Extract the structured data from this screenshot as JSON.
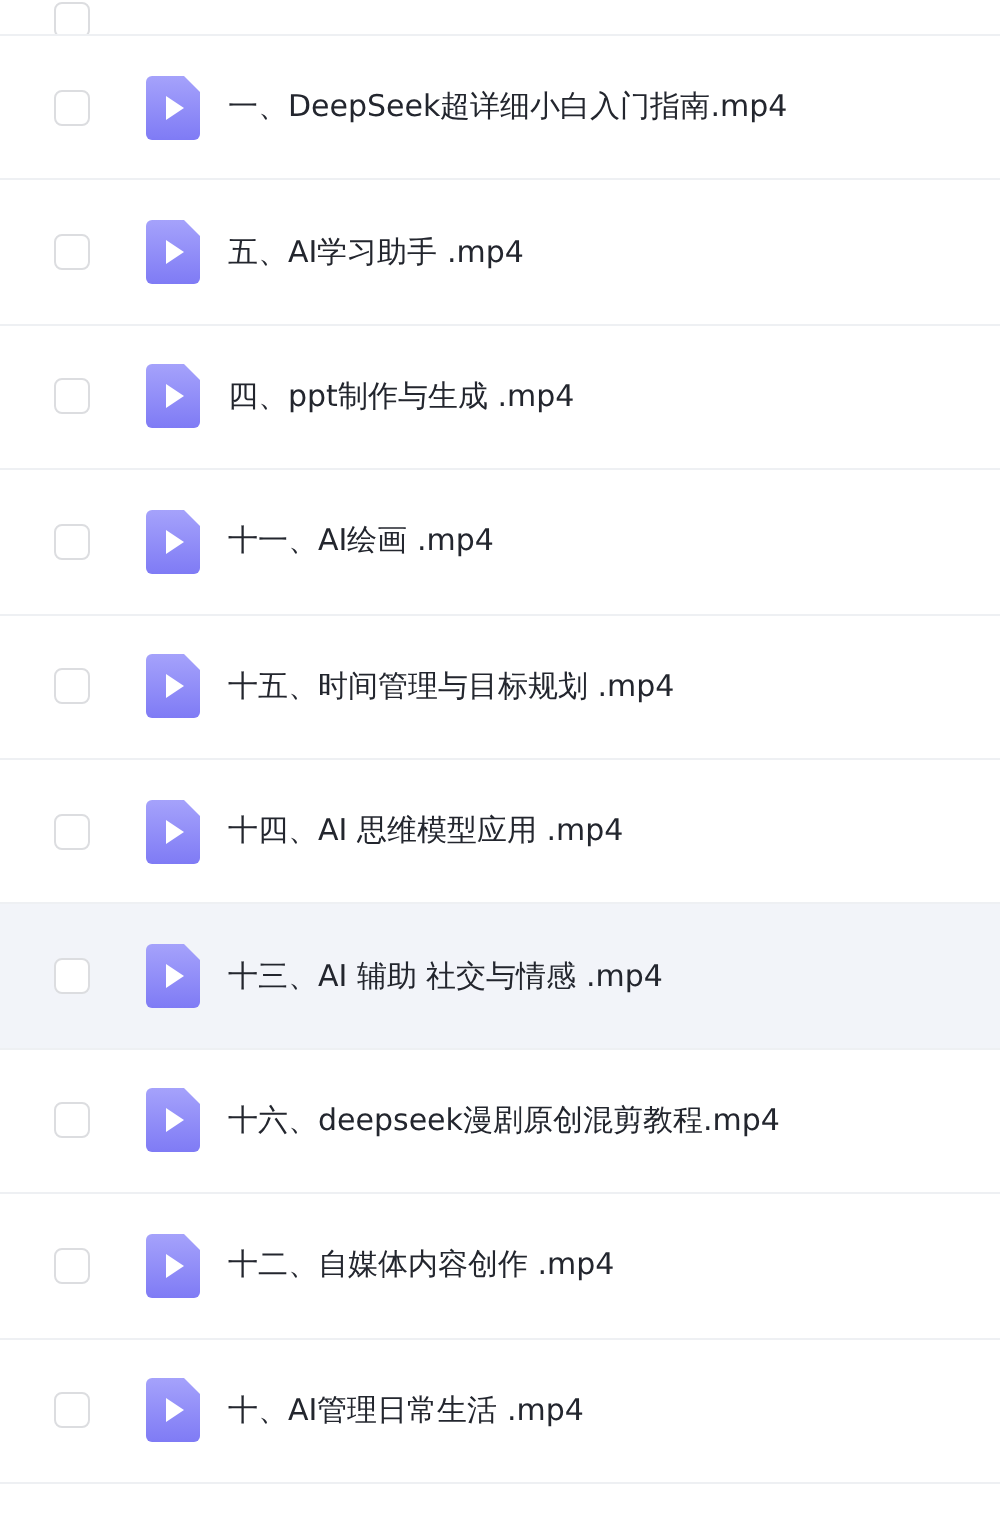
{
  "partial_row": {
    "checked": false
  },
  "files": [
    {
      "name": "一、DeepSeek超详细小白入门指南.mp4",
      "checked": false,
      "hovered": false
    },
    {
      "name": "五、AI学习助手 .mp4",
      "checked": false,
      "hovered": false
    },
    {
      "name": "四、ppt制作与生成 .mp4",
      "checked": false,
      "hovered": false
    },
    {
      "name": "十一、AI绘画 .mp4",
      "checked": false,
      "hovered": false
    },
    {
      "name": "十五、时间管理与目标规划 .mp4",
      "checked": false,
      "hovered": false
    },
    {
      "name": "十四、AI 思维模型应用 .mp4",
      "checked": false,
      "hovered": false
    },
    {
      "name": "十三、AI 辅助 社交与情感 .mp4",
      "checked": false,
      "hovered": true
    },
    {
      "name": "十六、deepseek漫剧原创混剪教程.mp4",
      "checked": false,
      "hovered": false
    },
    {
      "name": "十二、自媒体内容创作 .mp4",
      "checked": false,
      "hovered": false
    },
    {
      "name": "十、AI管理日常生活 .mp4",
      "checked": false,
      "hovered": false
    }
  ]
}
